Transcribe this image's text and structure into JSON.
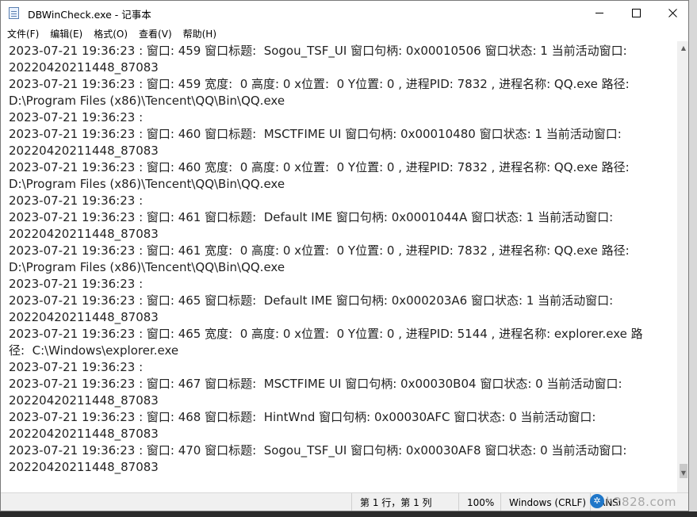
{
  "window": {
    "title": "DBWinCheck.exe - 记事本"
  },
  "menu": {
    "items": [
      "文件(F)",
      "编辑(E)",
      "格式(O)",
      "查看(V)",
      "帮助(H)"
    ]
  },
  "editor": {
    "lines": [
      "2023-07-21 19:36:23 : 窗口: 459 窗口标题:  Sogou_TSF_UI 窗口句柄: 0x00010506 窗口状态: 1 当前活动窗口:",
      "20220420211448_87083",
      "2023-07-21 19:36:23 : 窗口: 459 宽度:  0 高度: 0 x位置:  0 Y位置: 0 , 进程PID: 7832 , 进程名称: QQ.exe 路径:",
      "D:\\Program Files (x86)\\Tencent\\QQ\\Bin\\QQ.exe",
      "2023-07-21 19:36:23 :",
      "2023-07-21 19:36:23 : 窗口: 460 窗口标题:  MSCTFIME UI 窗口句柄: 0x00010480 窗口状态: 1 当前活动窗口:",
      "20220420211448_87083",
      "2023-07-21 19:36:23 : 窗口: 460 宽度:  0 高度: 0 x位置:  0 Y位置: 0 , 进程PID: 7832 , 进程名称: QQ.exe 路径:",
      "D:\\Program Files (x86)\\Tencent\\QQ\\Bin\\QQ.exe",
      "2023-07-21 19:36:23 :",
      "2023-07-21 19:36:23 : 窗口: 461 窗口标题:  Default IME 窗口句柄: 0x0001044A 窗口状态: 1 当前活动窗口:",
      "20220420211448_87083",
      "2023-07-21 19:36:23 : 窗口: 461 宽度:  0 高度: 0 x位置:  0 Y位置: 0 , 进程PID: 7832 , 进程名称: QQ.exe 路径:",
      "D:\\Program Files (x86)\\Tencent\\QQ\\Bin\\QQ.exe",
      "2023-07-21 19:36:23 :",
      "2023-07-21 19:36:23 : 窗口: 465 窗口标题:  Default IME 窗口句柄: 0x000203A6 窗口状态: 1 当前活动窗口:",
      "20220420211448_87083",
      "2023-07-21 19:36:23 : 窗口: 465 宽度:  0 高度: 0 x位置:  0 Y位置: 0 , 进程PID: 5144 , 进程名称: explorer.exe 路",
      "径:  C:\\Windows\\explorer.exe",
      "2023-07-21 19:36:23 :",
      "2023-07-21 19:36:23 : 窗口: 467 窗口标题:  MSCTFIME UI 窗口句柄: 0x00030B04 窗口状态: 0 当前活动窗口:",
      "20220420211448_87083",
      "2023-07-21 19:36:23 : 窗口: 468 窗口标题:  HintWnd 窗口句柄: 0x00030AFC 窗口状态: 0 当前活动窗口:",
      "20220420211448_87083",
      "2023-07-21 19:36:23 : 窗口: 470 窗口标题:  Sogou_TSF_UI 窗口句柄: 0x00030AF8 窗口状态: 0 当前活动窗口:",
      "20220420211448_87083"
    ]
  },
  "status": {
    "position": "第 1 行，第 1 列",
    "zoom": "100%",
    "line_ending": "Windows (CRLF)",
    "encoding": "ANSI"
  },
  "watermark": {
    "text": "h2828.com"
  },
  "icons": {
    "app": "notepad-icon",
    "minimize": "minimize-icon",
    "maximize": "maximize-icon",
    "close": "close-icon"
  }
}
